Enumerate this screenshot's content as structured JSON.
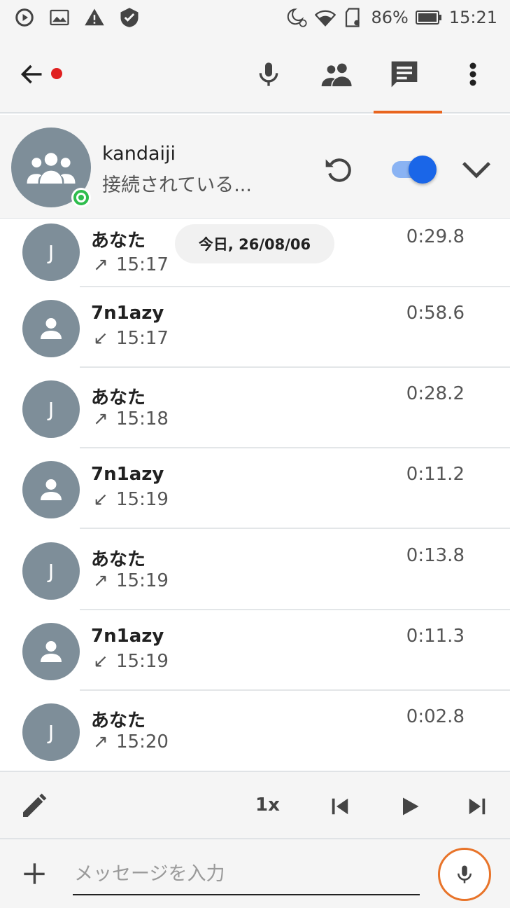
{
  "status_bar": {
    "battery": "86%",
    "time": "15:21",
    "icons_left": [
      "sync-icon",
      "image-icon",
      "warning-icon",
      "shield-check-icon"
    ],
    "icons_right": [
      "do-not-disturb-alarm-icon",
      "wifi-icon",
      "sd-card-icon",
      "battery-icon"
    ]
  },
  "app_bar": {
    "actions": [
      "microphone-icon",
      "people-icon",
      "chat-icon",
      "more-vert-icon"
    ],
    "active_tab": "chat-icon",
    "accent": "#e8651f"
  },
  "channel": {
    "name": "kandaiji",
    "status": "接続されている...",
    "online": true,
    "toggle_on": true
  },
  "date_chip": "今日, 26/08/06",
  "messages": [
    {
      "avatar": "J",
      "sender": "あなた",
      "direction": "↗",
      "time": "15:17",
      "duration": "0:29.8"
    },
    {
      "avatar": "",
      "sender": "7n1azy",
      "direction": "↙",
      "time": "15:17",
      "duration": "0:58.6"
    },
    {
      "avatar": "J",
      "sender": "あなた",
      "direction": "↗",
      "time": "15:18",
      "duration": "0:28.2"
    },
    {
      "avatar": "",
      "sender": "7n1azy",
      "direction": "↙",
      "time": "15:19",
      "duration": "0:11.2"
    },
    {
      "avatar": "J",
      "sender": "あなた",
      "direction": "↗",
      "time": "15:19",
      "duration": "0:13.8"
    },
    {
      "avatar": "",
      "sender": "7n1azy",
      "direction": "↙",
      "time": "15:19",
      "duration": "0:11.3"
    },
    {
      "avatar": "J",
      "sender": "あなた",
      "direction": "↗",
      "time": "15:20",
      "duration": "0:02.8"
    }
  ],
  "player": {
    "speed": "1x"
  },
  "input": {
    "placeholder": "メッセージを入力",
    "value": ""
  }
}
